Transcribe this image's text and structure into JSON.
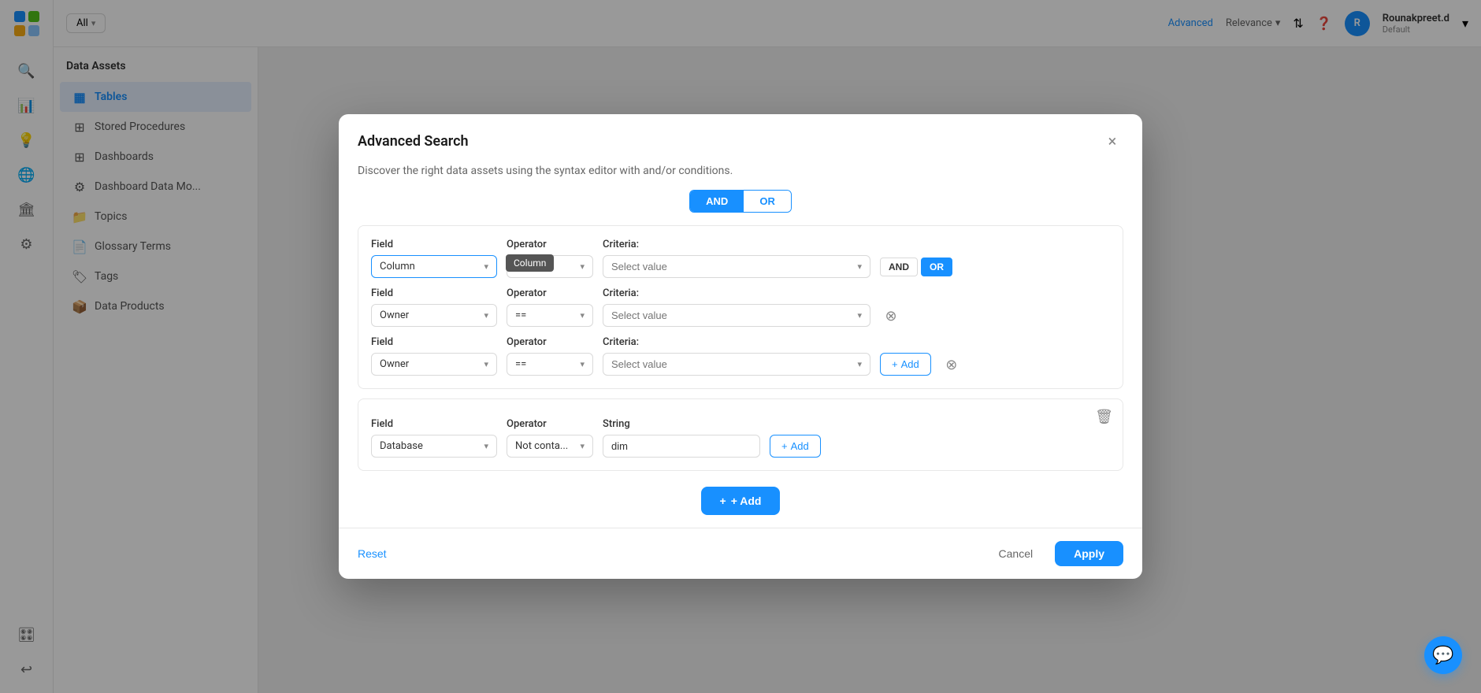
{
  "app": {
    "logo_text": "≡",
    "title": "Advanced Search"
  },
  "topbar": {
    "filter_label": "All",
    "filter_chevron": "▾",
    "advanced_link": "Advanced",
    "relevance_label": "Relevance",
    "user_initial": "R",
    "user_name": "Rounakpreet.d",
    "user_role": "Default"
  },
  "sidebar_icons": [
    "☁",
    "🔍",
    "💡",
    "🌐",
    "🏛",
    "📋",
    "⊡",
    "↩"
  ],
  "left_panel": {
    "title": "Data Assets",
    "nav_items": [
      {
        "label": "Tables",
        "icon": "▦",
        "active": true
      },
      {
        "label": "Stored Procedures",
        "icon": "⊞",
        "active": false
      },
      {
        "label": "Dashboards",
        "icon": "⊞",
        "active": false
      },
      {
        "label": "Dashboard Data Mo...",
        "icon": "⚙",
        "active": false
      },
      {
        "label": "Topics",
        "icon": "📁",
        "active": false
      },
      {
        "label": "Glossary Terms",
        "icon": "📄",
        "active": false
      },
      {
        "label": "Tags",
        "icon": "🏷",
        "active": false
      },
      {
        "label": "Data Products",
        "icon": "📦",
        "active": false
      }
    ]
  },
  "modal": {
    "title": "Advanced Search",
    "subtitle": "Discover the right data assets using the syntax editor with and/or conditions.",
    "close_icon": "×",
    "condition_toggle": {
      "and_label": "AND",
      "or_label": "OR",
      "active": "AND"
    },
    "block1": {
      "rows": [
        {
          "field_label": "Field",
          "field_value": "Column",
          "operator_label": "Operator",
          "operator_value": "==",
          "criteria_label": "Criteria:",
          "criteria_placeholder": "Select value",
          "show_row_toggle": true,
          "row_and_label": "AND",
          "row_or_label": "OR",
          "row_active": "OR",
          "tooltip": "Column"
        },
        {
          "field_label": "Field",
          "field_value": "Owner",
          "operator_label": "Operator",
          "operator_value": "==",
          "criteria_label": "Criteria:",
          "criteria_placeholder": "Select value",
          "show_remove": true
        },
        {
          "field_label": "Field",
          "field_value": "Owner",
          "operator_label": "Operator",
          "operator_value": "==",
          "criteria_label": "Criteria:",
          "criteria_placeholder": "Select value",
          "show_remove": true,
          "show_add": true
        }
      ]
    },
    "block2": {
      "rows": [
        {
          "field_label": "Field",
          "field_value": "Database",
          "operator_label": "Operator",
          "operator_value": "Not conta...",
          "criteria_label": "String",
          "criteria_value": "dim",
          "show_add": true
        }
      ]
    },
    "add_block_label": "+ Add",
    "footer": {
      "reset_label": "Reset",
      "cancel_label": "Cancel",
      "apply_label": "Apply"
    }
  },
  "chat_btn": "💬"
}
